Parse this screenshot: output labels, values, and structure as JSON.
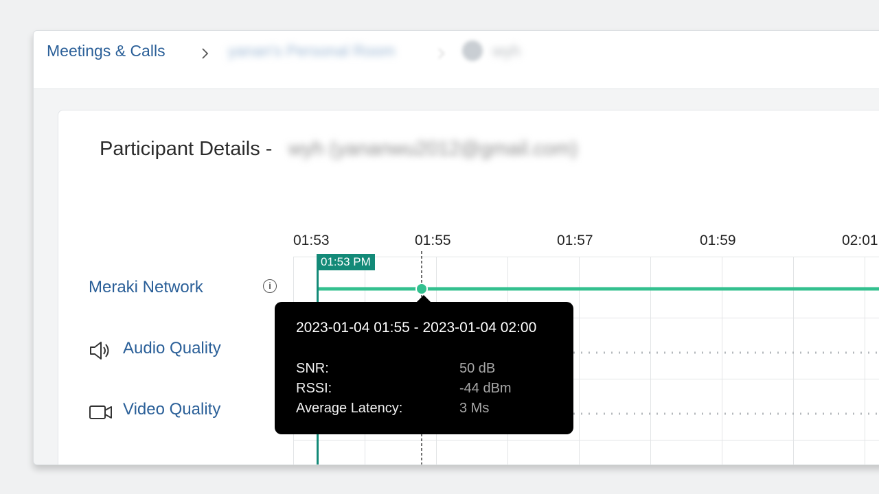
{
  "breadcrumb": {
    "root": "Meetings & Calls",
    "room": "yanan's Personal Room",
    "participant": "wyh"
  },
  "header": {
    "title": "Participant Details -",
    "participant_id": "wyh (yananwu2012@gmail.com)"
  },
  "rows": {
    "network": "Meraki Network",
    "audio": "Audio Quality",
    "video": "Video Quality"
  },
  "timeline": {
    "ticks": [
      "01:53",
      "01:55",
      "01:57",
      "01:59",
      "02:01"
    ],
    "join_time": "01:53 PM",
    "line_color": "#33c08f",
    "marker_color": "#138a78"
  },
  "tooltip": {
    "range": "2023-01-04 01:55 - 2023-01-04 02:00",
    "metrics": [
      {
        "label": "SNR:",
        "value": "50 dB"
      },
      {
        "label": "RSSI:",
        "value": "-44 dBm"
      },
      {
        "label": "Average Latency:",
        "value": "3 Ms"
      }
    ]
  }
}
